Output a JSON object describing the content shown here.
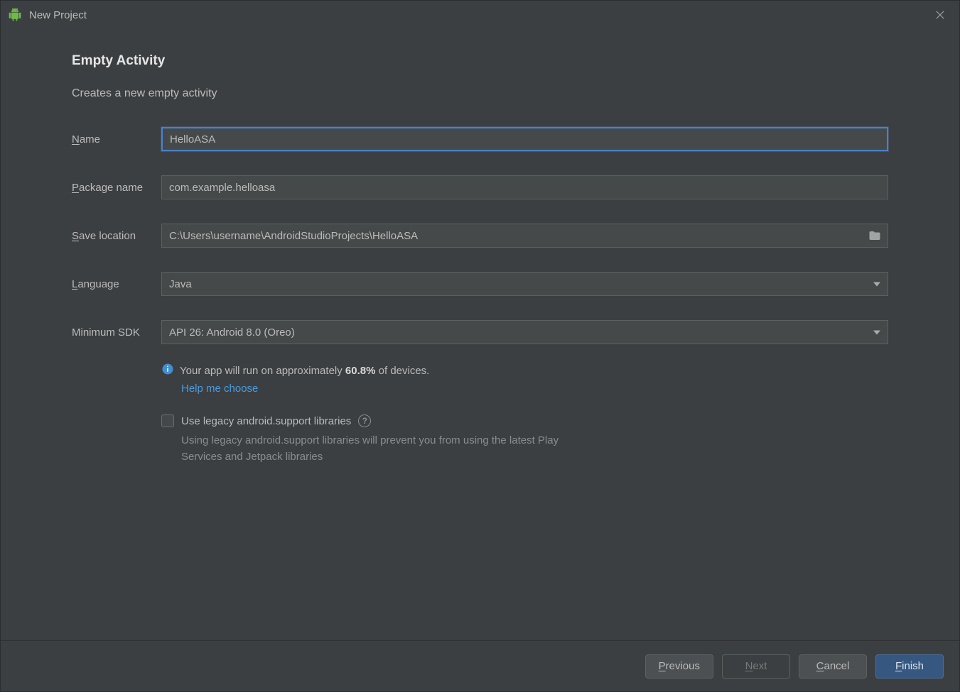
{
  "titlebar": {
    "title": "New Project"
  },
  "heading": "Empty Activity",
  "subtitle": "Creates a new empty activity",
  "labels": {
    "name": "ame",
    "name_mn": "N",
    "package": "ackage name",
    "package_mn": "P",
    "save": "ave location",
    "save_mn": "S",
    "language": "anguage",
    "language_mn": "L",
    "minsdk": "Minimum SDK"
  },
  "fields": {
    "name": "HelloASA",
    "package": "com.example.helloasa",
    "save": "C:\\Users\\username\\AndroidStudioProjects\\HelloASA",
    "language": "Java",
    "minsdk": "API 26: Android 8.0 (Oreo)"
  },
  "info": {
    "text_pre": "Your app will run on approximately ",
    "percent": "60.8%",
    "text_post": " of devices.",
    "link": "Help me choose"
  },
  "legacy": {
    "label": "Use legacy android.support libraries",
    "desc": "Using legacy android.support libraries will prevent you from using the latest Play Services and Jetpack libraries"
  },
  "footer": {
    "previous_mn": "P",
    "previous": "revious",
    "next_mn": "N",
    "next": "ext",
    "cancel_mn": "C",
    "cancel": "ancel",
    "finish_mn": "F",
    "finish": "inish"
  }
}
